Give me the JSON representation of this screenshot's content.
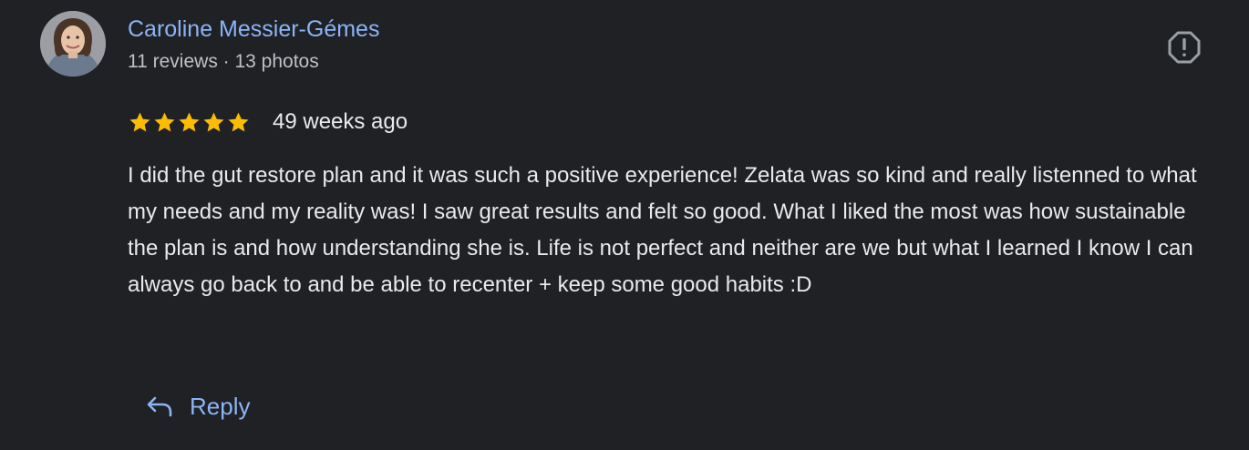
{
  "review": {
    "author_name": "Caroline Messier-Gémes",
    "author_meta": "11 reviews · 13 photos",
    "rating": 5,
    "rating_max": 5,
    "time_ago": "49 weeks ago",
    "text": "I did the gut restore plan and it was such a positive experience! Zelata was so kind and really listenned to what my needs and my reality was! I saw great results and felt so good. What I liked the most was how sustainable the plan is and how understanding she is. Life is not perfect and neither are we but what I learned I know I can always go back to and be able to recenter + keep some good habits :D"
  },
  "actions": {
    "reply_label": "Reply",
    "reply_icon": "reply-arrow-icon",
    "flag_icon": "report-flag-icon"
  },
  "colors": {
    "background": "#202124",
    "accent": "#8ab4f8",
    "star": "#fbbc04",
    "text_primary": "#e8eaed",
    "text_secondary": "#bdc1c6",
    "icon": "#9aa0a6"
  }
}
